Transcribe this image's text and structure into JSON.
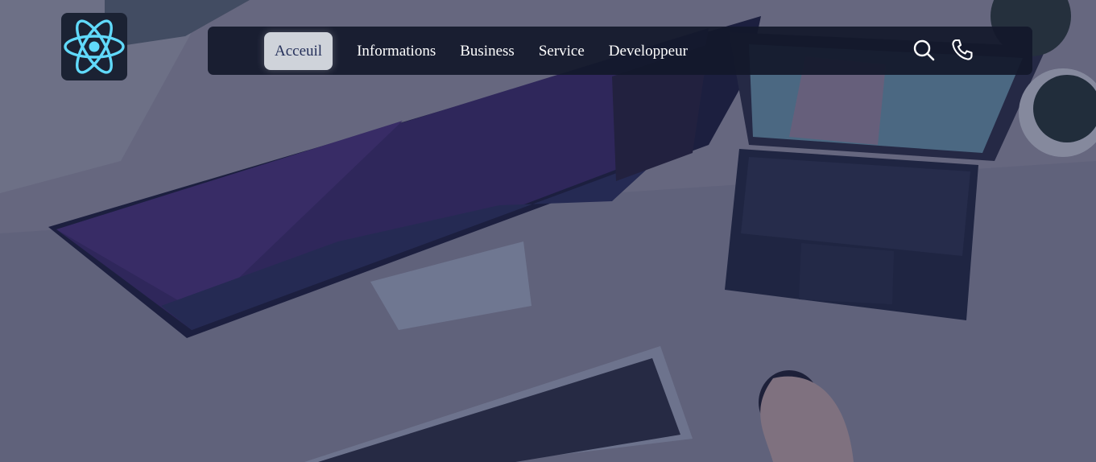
{
  "brand": {
    "logo_icon": "react-atom-icon",
    "logo_color": "#61dafb"
  },
  "nav": {
    "items": [
      {
        "label": "Acceuil",
        "active": true
      },
      {
        "label": "Informations",
        "active": false
      },
      {
        "label": "Business",
        "active": false
      },
      {
        "label": "Service",
        "active": false
      },
      {
        "label": "Developpeur",
        "active": false
      }
    ],
    "icons": [
      "search-icon",
      "phone-icon"
    ]
  },
  "hero": {
    "background_image": "desk-setup-photo"
  },
  "colors": {
    "nav_bg": "#12182a",
    "active_bg": "#cfd3da",
    "active_text": "#25305a",
    "text": "#ffffff"
  }
}
